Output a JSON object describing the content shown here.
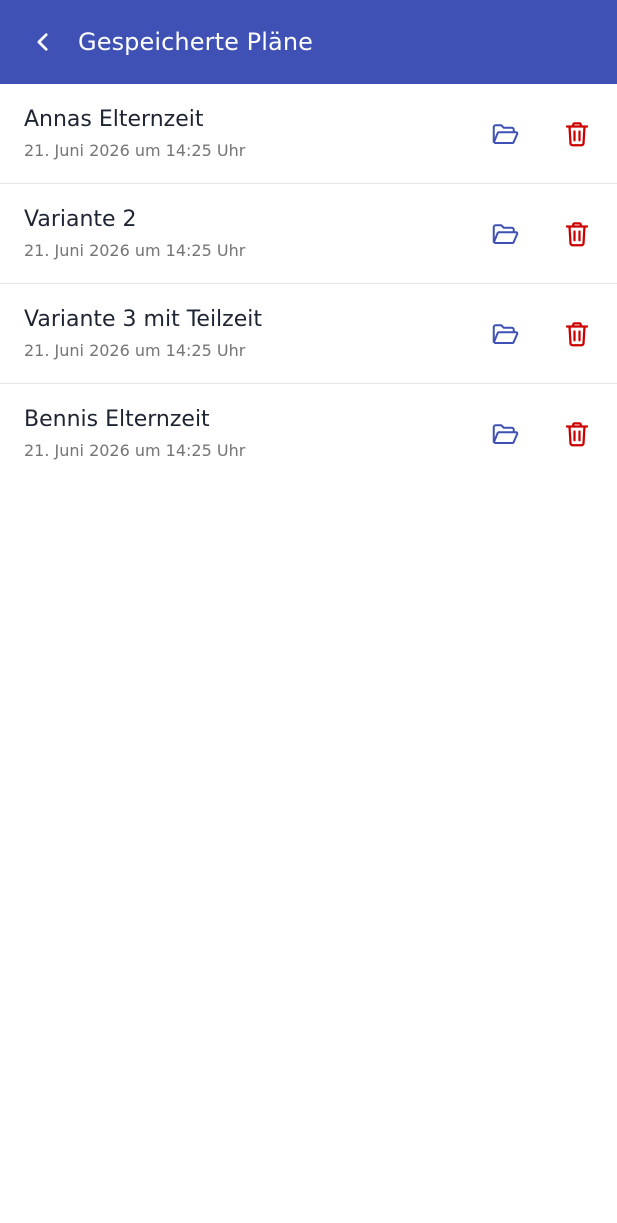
{
  "header": {
    "title": "Gespeicherte Pläne",
    "back_icon": "chevron-left-icon"
  },
  "colors": {
    "app_bar": "#3f51b5",
    "open_icon": "#3f51b5",
    "delete_icon": "#cc0000"
  },
  "plans": [
    {
      "name": "Annas Elternzeit",
      "date": "21. Juni 2026 um 14:25 Uhr"
    },
    {
      "name": "Variante 2",
      "date": "21. Juni 2026 um 14:25 Uhr"
    },
    {
      "name": "Variante 3 mit Teilzeit",
      "date": "21. Juni 2026 um 14:25 Uhr"
    },
    {
      "name": "Bennis Elternzeit",
      "date": "21. Juni 2026 um 14:25 Uhr"
    }
  ],
  "icons": {
    "open": "folder-open-icon",
    "delete": "trash-icon"
  }
}
